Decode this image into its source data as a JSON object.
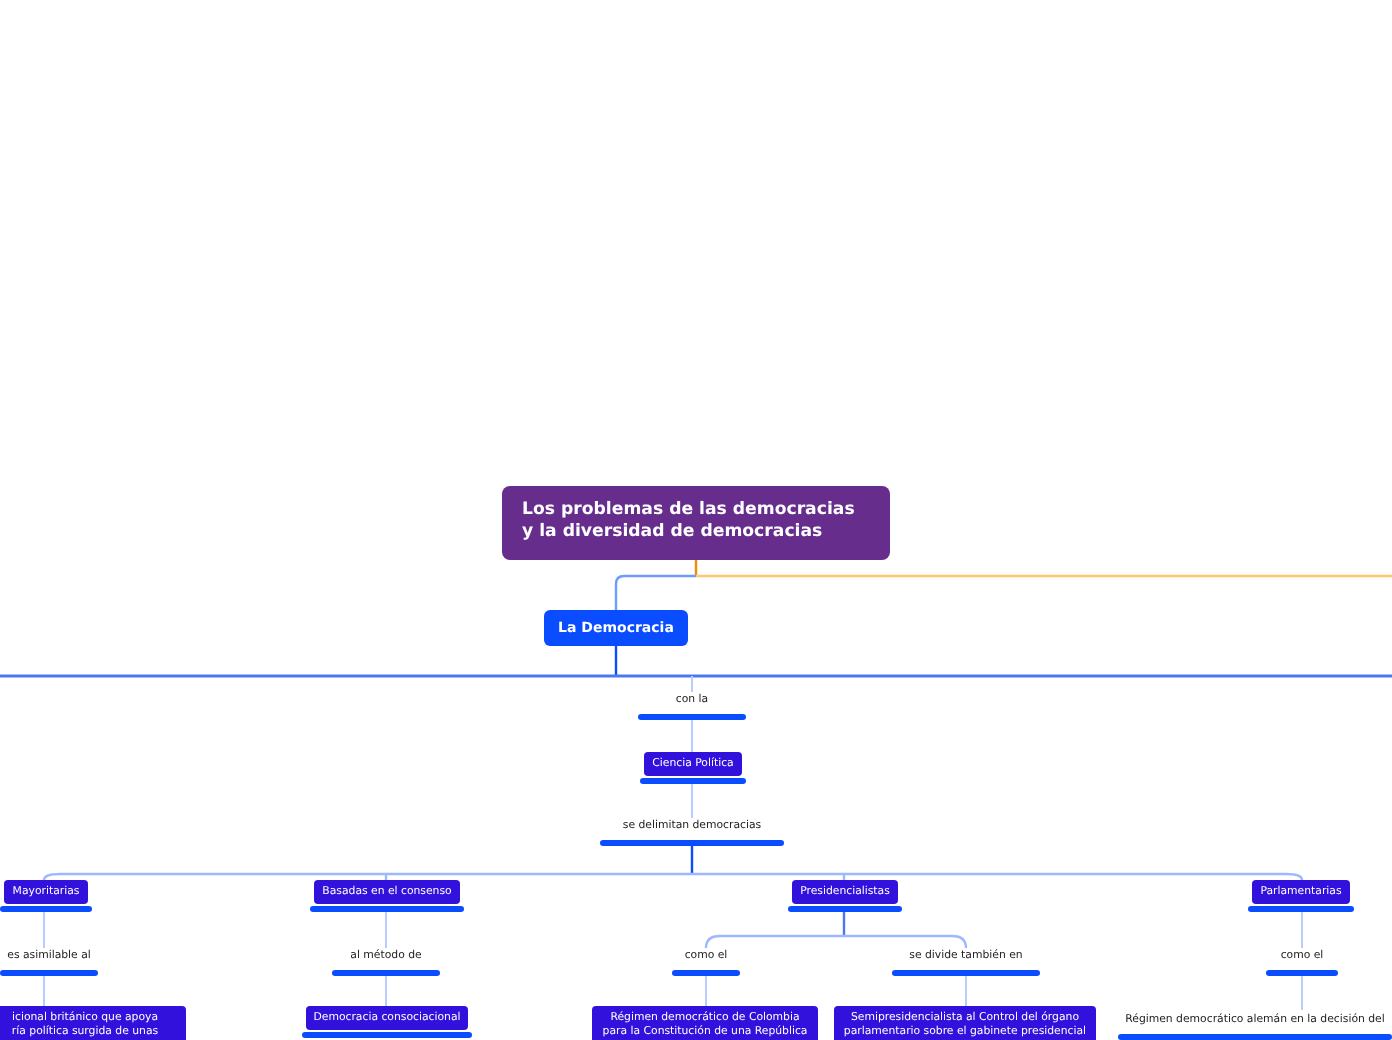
{
  "nodes": [
    {
      "kind": "central",
      "text": "Los problemas de las democracias\ny la diversidad de democracias"
    },
    {
      "kind": "main",
      "text": "La Democracia"
    },
    {
      "kind": "label",
      "text": "con la"
    },
    {
      "kind": "subtopic",
      "text": "Ciencia Política"
    },
    {
      "kind": "label",
      "text": "se delimitan democracias"
    },
    {
      "kind": "subtopic",
      "text": "Mayoritarias"
    },
    {
      "kind": "subtopic",
      "text": "Basadas en el consenso"
    },
    {
      "kind": "subtopic",
      "text": "Presidencialistas"
    },
    {
      "kind": "subtopic",
      "text": "Parlamentarias"
    },
    {
      "kind": "label",
      "text": "es asimilable al"
    },
    {
      "kind": "label",
      "text": "al método de"
    },
    {
      "kind": "label",
      "text": "como el"
    },
    {
      "kind": "label",
      "text": "se divide también en"
    },
    {
      "kind": "label",
      "text": "como el"
    },
    {
      "kind": "subtopic",
      "text": "icional británico que apoya\nría política surgida de unas"
    },
    {
      "kind": "subtopic",
      "text": "Democracia consociacional"
    },
    {
      "kind": "subtopic",
      "text": "Régimen democrático de Colombia\npara la Constitución de una República"
    },
    {
      "kind": "subtopic",
      "text": "Semipresidencialista al Control del órgano\nparlamentario sobre el gabinete presidencial"
    },
    {
      "kind": "label",
      "text": "Régimen democrático alemán en la decisión del"
    }
  ]
}
